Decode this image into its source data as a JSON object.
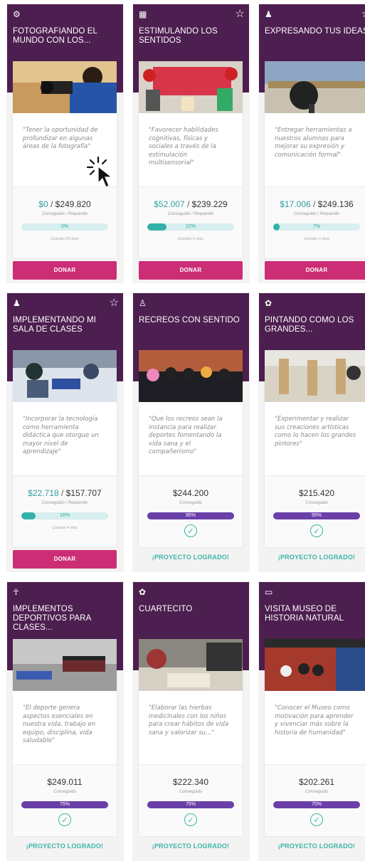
{
  "cards": [
    {
      "title": "FOTOGRAFIANDO EL MUNDO CON LOS...",
      "icon": "camera-icon",
      "star": false,
      "quote": "\"Tener la oportunidad de profundizar en algunas áreas de la fotografía\"",
      "got": "$0",
      "req": "$249.820",
      "label": "Conseguido / Requerido",
      "pct_text": "0%",
      "pct": 0,
      "remain": "Quedan 83 días",
      "state": "funding",
      "button": "DONAR"
    },
    {
      "title": "ESTIMULANDO LOS SENTIDOS",
      "icon": "book-icon",
      "star": true,
      "quote": "\"Favorecer habilidades cognitivas, físicas y sociales a través de la estimulación multisensorial\"",
      "got": "$52.007",
      "req": "$239.229",
      "label": "Conseguido / Requerido",
      "pct_text": "22%",
      "pct": 22,
      "remain": "Quedan 6 días",
      "state": "funding",
      "button": "DONAR"
    },
    {
      "title": "EXPRESANDO TUS IDEAS",
      "icon": "person-icon",
      "star": true,
      "quote": "\"Entregar herramientas a nuestros alumnos para mejorar su expresión y comunicación formal\"",
      "got": "$17.006",
      "req": "$249.136",
      "label": "Conseguido / Requerido",
      "pct_text": "7%",
      "pct": 7,
      "remain": "Quedan 5 días",
      "state": "funding",
      "button": "DONAR"
    },
    {
      "title": "IMPLEMENTANDO MI SALA DE CLASES",
      "icon": "person-icon",
      "star": true,
      "quote": "\"Incorporar la tecnología como herramienta didáctica que otorgue un mayor nivel de aprendizaje\"",
      "got": "$22.718",
      "req": "$157.707",
      "label": "Conseguido / Requerido",
      "pct_text": "16%",
      "pct": 16,
      "remain": "Quedan 4 días",
      "state": "funding",
      "button": "DONAR"
    },
    {
      "title": "RECREOS CON SENTIDO",
      "icon": "playground-icon",
      "star": false,
      "quote": "\"Que los recreos sean la instancia para realizar deportes fomentando la vida sana y el compañerismo\"",
      "got": "$244.200",
      "req": "",
      "label": "Conseguido",
      "pct_text": "95%",
      "pct": 95,
      "remain": "",
      "state": "done",
      "button": "¡PROYECTO LOGRADO!"
    },
    {
      "title": "PINTANDO COMO LOS GRANDES...",
      "icon": "palette-icon",
      "star": false,
      "quote": "\"Experimentar y realizar sus creaciones artísticas como lo hacen los grandes pintores\"",
      "got": "$215.420",
      "req": "",
      "label": "Conseguido",
      "pct_text": "95%",
      "pct": 95,
      "remain": "",
      "state": "done",
      "button": "¡PROYECTO LOGRADO!"
    },
    {
      "title": "IMPLEMENTOS DEPORTIVOS PARA CLASES...",
      "icon": "sports-icon",
      "star": false,
      "quote": "\"El deporte genera aspectos esenciales en nuestra vida, trabajo en equipo, disciplina, vida saludable\"",
      "got": "$249.011",
      "req": "",
      "label": "Conseguido",
      "pct_text": "75%",
      "pct": 75,
      "remain": "",
      "state": "done",
      "button": "¡PROYECTO LOGRADO!"
    },
    {
      "title": "CUARTECITO",
      "icon": "palette-icon",
      "star": false,
      "quote": "\"Elaborar las hierbas medicinales con los niños para crear hábitos de vida sana y valorizar su...\"",
      "got": "$222.340",
      "req": "",
      "label": "Conseguido",
      "pct_text": "75%",
      "pct": 75,
      "remain": "",
      "state": "done",
      "button": "¡PROYECTO LOGRADO!"
    },
    {
      "title": "VISITA MUSEO DE HISTORIA NATURAL",
      "icon": "bus-icon",
      "star": false,
      "quote": "\"Conocer el Museo como motivación para aprender y vivenciar más sobre la historia de humanidad\"",
      "got": "$202.261",
      "req": "",
      "label": "Conseguido",
      "pct_text": "75%",
      "pct": 75,
      "remain": "",
      "state": "done",
      "button": "¡PROYECTO LOGRADO!"
    }
  ],
  "colors": {
    "header": "#4d1f50",
    "donate": "#cc2e75",
    "teal": "#33b1a8",
    "purple": "#6a3fa8"
  }
}
